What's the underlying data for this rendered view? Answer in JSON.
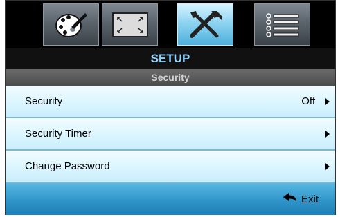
{
  "tabs": [
    {
      "icon": "palette-icon",
      "active": false
    },
    {
      "icon": "display-resize-icon",
      "active": false
    },
    {
      "icon": "tools-icon",
      "active": true
    },
    {
      "icon": "options-list-icon",
      "active": false
    }
  ],
  "header": {
    "title": "SETUP",
    "subtitle": "Security"
  },
  "menu": {
    "items": [
      {
        "label": "Security",
        "value": "Off"
      },
      {
        "label": "Security Timer",
        "value": ""
      },
      {
        "label": "Change Password",
        "value": ""
      }
    ]
  },
  "footer": {
    "exit_label": "Exit"
  }
}
